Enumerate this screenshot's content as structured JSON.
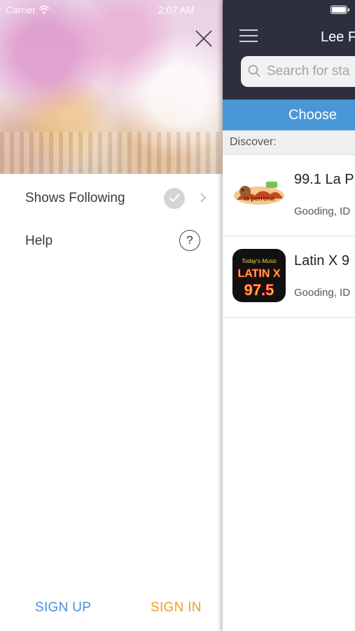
{
  "status_bar": {
    "carrier": "Carrier",
    "time": "2:07 AM"
  },
  "drawer": {
    "menu": [
      {
        "label": "Shows Following"
      },
      {
        "label": "Help"
      }
    ],
    "help_glyph": "?",
    "sign_up": "SIGN UP",
    "sign_in": "SIGN IN"
  },
  "main": {
    "title": "Lee F",
    "search_placeholder": "Search for sta",
    "choose_label": "Choose",
    "discover_label": "Discover:",
    "stations": [
      {
        "name": "99.1 La P",
        "location": "Gooding, ID",
        "logo_text": "la perrona"
      },
      {
        "name": "Latin X 9",
        "location": "Gooding, ID",
        "logo_text": "LATIN X 97.5"
      }
    ]
  },
  "colors": {
    "nav_bg": "#2e2f3e",
    "accent_blue": "#4a97d8",
    "sign_up": "#4a8fd8",
    "sign_in": "#f0a020"
  },
  "icons": [
    "close-icon",
    "wifi-icon",
    "check-icon",
    "chevron-right-icon",
    "help-icon",
    "battery-icon",
    "menu-icon",
    "search-icon"
  ]
}
